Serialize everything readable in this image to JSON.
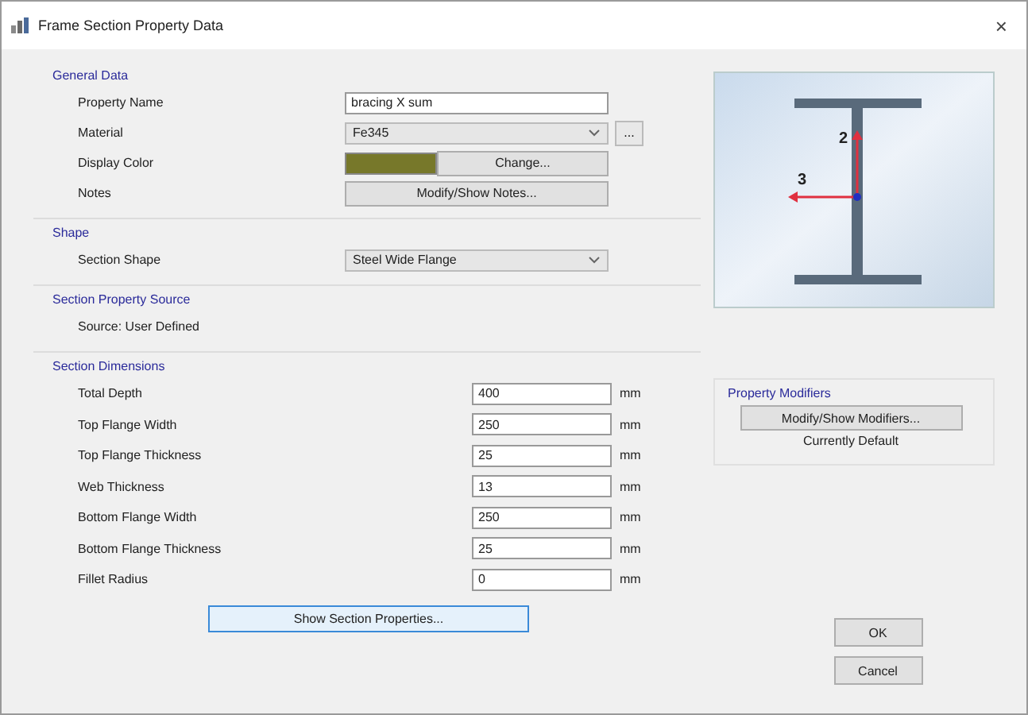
{
  "window": {
    "title": "Frame Section Property Data",
    "close": "×"
  },
  "general": {
    "title": "General Data",
    "property_name": {
      "label": "Property Name",
      "value": "bracing X sum"
    },
    "material": {
      "label": "Material",
      "value": "Fe345",
      "more": "..."
    },
    "display_color": {
      "label": "Display Color",
      "color": "#77782a",
      "button": "Change..."
    },
    "notes": {
      "label": "Notes",
      "button": "Modify/Show Notes..."
    }
  },
  "shape": {
    "title": "Shape",
    "label": "Section Shape",
    "value": "Steel Wide Flange"
  },
  "source": {
    "title": "Section Property Source",
    "text": "Source:  User Defined"
  },
  "dimensions": {
    "title": "Section Dimensions",
    "rows": [
      {
        "label": "Total Depth",
        "value": "400",
        "unit": "mm"
      },
      {
        "label": "Top Flange Width",
        "value": "250",
        "unit": "mm"
      },
      {
        "label": "Top Flange Thickness",
        "value": "25",
        "unit": "mm"
      },
      {
        "label": "Web Thickness",
        "value": "13",
        "unit": "mm"
      },
      {
        "label": "Bottom Flange Width",
        "value": "250",
        "unit": "mm"
      },
      {
        "label": "Bottom Flange Thickness",
        "value": "25",
        "unit": "mm"
      },
      {
        "label": "Fillet Radius",
        "value": "0",
        "unit": "mm"
      }
    ],
    "button": "Show Section Properties..."
  },
  "preview": {
    "axis_vertical": "2",
    "axis_horizontal": "3"
  },
  "modifiers": {
    "title": "Property Modifiers",
    "button": "Modify/Show Modifiers...",
    "status": "Currently Default"
  },
  "buttons": [
    "OK",
    "Cancel"
  ]
}
